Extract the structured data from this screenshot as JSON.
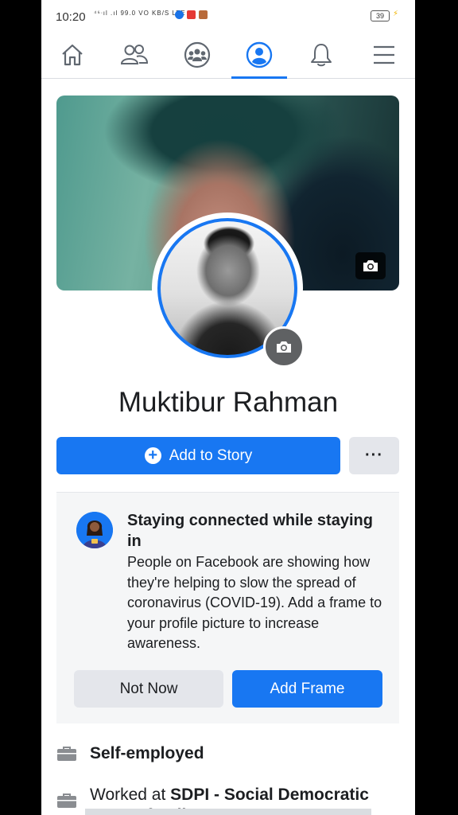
{
  "status_bar": {
    "time": "10:20",
    "signal_text": "⁴⁶ᐧıl .ıl 99.0 VO KB/S LTE",
    "battery": "39",
    "app_colors": [
      "#1a73e8",
      "#e53935",
      "#ffa000"
    ]
  },
  "nav": {
    "items": [
      {
        "icon": "home-icon"
      },
      {
        "icon": "friends-icon"
      },
      {
        "icon": "groups-icon"
      },
      {
        "icon": "profile-icon"
      },
      {
        "icon": "bell-icon"
      },
      {
        "icon": "menu-icon"
      }
    ],
    "active_index": 3
  },
  "profile": {
    "name": "Muktibur Rahman"
  },
  "actions": {
    "add_to_story": "Add to Story",
    "more": "···"
  },
  "covid_card": {
    "title": "Staying connected while staying in",
    "body": "People on Facebook are showing how they're helping to slow the spread of coronavirus (COVID-19). Add a frame to your profile picture to increase awareness.",
    "not_now": "Not Now",
    "add_frame": "Add Frame"
  },
  "info": {
    "job": "Self-employed",
    "worked_prefix": "Worked at",
    "worked_org": "SDPI - Social Democratic Party of India"
  },
  "colors": {
    "accent": "#1877f2",
    "secondary_button": "#e4e6eb",
    "text": "#1c1e21"
  }
}
